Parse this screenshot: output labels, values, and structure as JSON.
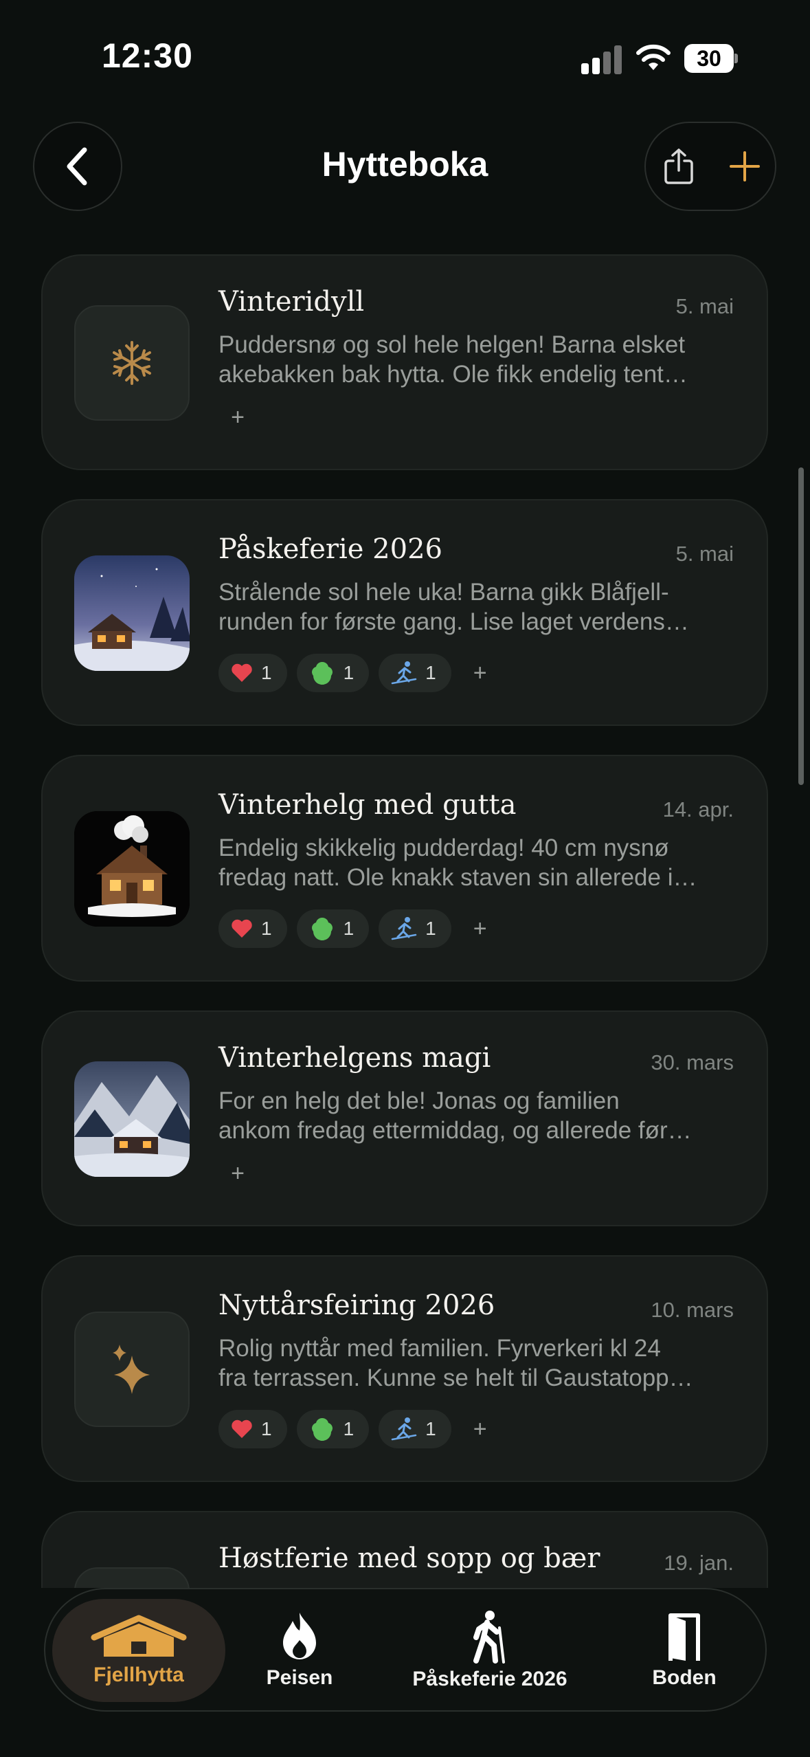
{
  "status_bar": {
    "time": "12:30",
    "battery": "30"
  },
  "header": {
    "title": "Hytteboka",
    "back_icon": "chevron-left-icon",
    "share_icon": "share-icon",
    "add_icon": "plus-icon"
  },
  "colors": {
    "accent": "#e3a547",
    "background": "#0c100e",
    "card": "#181c1a"
  },
  "entries": [
    {
      "title": "Vinteridyll",
      "date": "5. mai",
      "line1": "Puddersnø og sol hele helgen! Barna elsket",
      "line2": "akebakken bak hytta. Ole fikk endelig tent…",
      "thumb": "snowflake-icon",
      "reactions": []
    },
    {
      "title": "Påskeferie 2026",
      "date": "5. mai",
      "line1": "Strålende sol hele uka! Barna gikk Blåfjell-",
      "line2": "runden for første gang. Lise laget verdens…",
      "thumb": "cabin-night-image",
      "reactions": [
        {
          "icon": "heart-icon",
          "count": "1"
        },
        {
          "icon": "tree-icon",
          "count": "1"
        },
        {
          "icon": "skier-icon",
          "count": "1"
        }
      ]
    },
    {
      "title": "Vinterhelg med gutta",
      "date": "14. apr.",
      "line1": "Endelig skikkelig pudderdag! 40 cm nysnø",
      "line2": "fredag natt. Ole knakk staven sin allerede i…",
      "thumb": "cabin-chimney-image",
      "reactions": [
        {
          "icon": "heart-icon",
          "count": "1"
        },
        {
          "icon": "tree-icon",
          "count": "1"
        },
        {
          "icon": "skier-icon",
          "count": "1"
        }
      ]
    },
    {
      "title": "Vinterhelgens magi",
      "date": "30. mars",
      "line1": "For en helg det ble! Jonas og familien",
      "line2": "ankom fredag ettermiddag, og allerede før…",
      "thumb": "cabin-mountain-image",
      "reactions": []
    },
    {
      "title": "Nyttårsfeiring 2026",
      "date": "10. mars",
      "line1": "Rolig nyttår med familien. Fyrverkeri kl 24",
      "line2": "fra terrassen. Kunne se helt til Gaustatopp…",
      "thumb": "sparkles-icon",
      "reactions": [
        {
          "icon": "heart-icon",
          "count": "1"
        },
        {
          "icon": "tree-icon",
          "count": "1"
        },
        {
          "icon": "skier-icon",
          "count": "1"
        }
      ]
    },
    {
      "title": "Høstferie med sopp og bær",
      "date": "19. jan."
    }
  ],
  "add_reaction_label": "+",
  "tabs": [
    {
      "label": "Fjellhytta",
      "icon": "cabin-icon",
      "active": true
    },
    {
      "label": "Peisen",
      "icon": "flame-icon",
      "active": false
    },
    {
      "label": "Påskeferie 2026",
      "icon": "hiker-icon",
      "active": false
    },
    {
      "label": "Boden",
      "icon": "door-icon",
      "active": false
    }
  ]
}
